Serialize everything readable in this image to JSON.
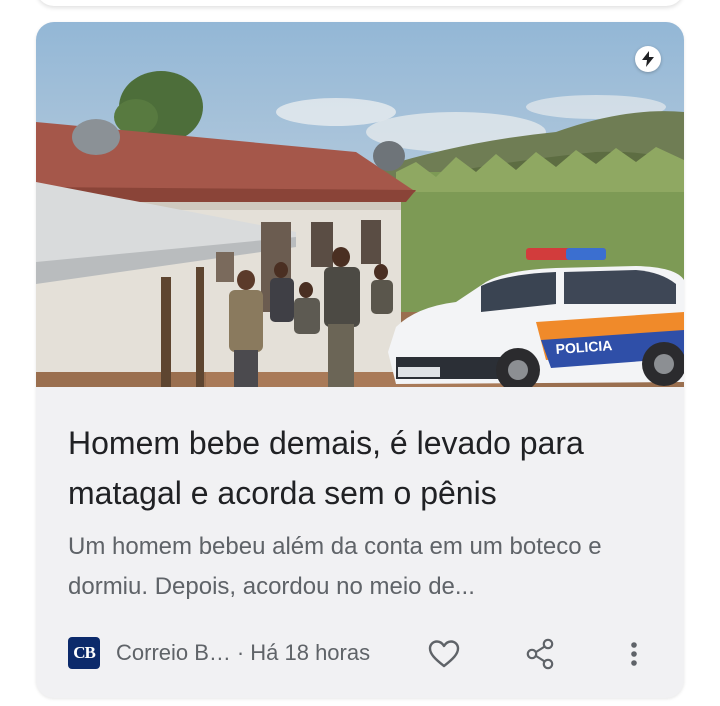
{
  "article": {
    "title": "Homem bebe demais, é levado para matagal e acorda sem o pênis",
    "snippet": "Um homem bebeu além da conta em um boteco e dormiu. Depois, acordou no meio de...",
    "image_text": "POLICIA",
    "publisher": {
      "logo_text": "CB",
      "name": "Correio B…",
      "logo_color": "#0c2a6b"
    },
    "separator": "·",
    "time": "Há 18 horas"
  },
  "icons": {
    "amp": "lightning-bolt-icon",
    "like": "heart-icon",
    "share": "share-icon",
    "more": "more-vert-icon"
  },
  "colors": {
    "card_background": "#f1f1f3",
    "title_text": "#202124",
    "secondary_text": "#5f6368"
  }
}
